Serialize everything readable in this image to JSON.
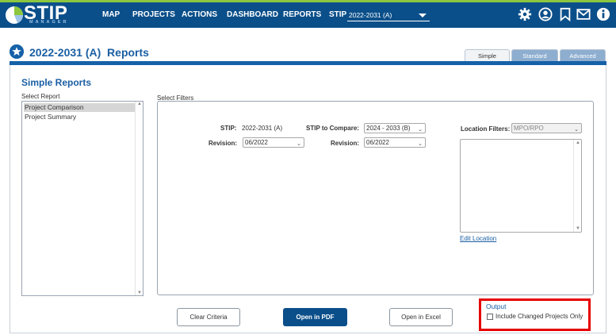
{
  "logo": {
    "text": "STIP",
    "subtext": "MANAGER"
  },
  "nav": {
    "items": [
      "MAP",
      "PROJECTS",
      "ACTIONS",
      "DASHBOARD",
      "REPORTS"
    ],
    "stip_label": "STIP",
    "stip_value": "2022-2031 (A)"
  },
  "toolbar_icons": [
    "gear-icon",
    "user-icon",
    "bookmark-icon",
    "mail-icon",
    "info-icon"
  ],
  "page": {
    "title": "2022-2031 (A)  Reports",
    "tabs": [
      "Simple",
      "Standard",
      "Advanced"
    ],
    "active_tab": "Simple"
  },
  "reports": {
    "section_title": "Simple Reports",
    "select_label": "Select Report",
    "items": [
      "Project Comparison",
      "Project Summary"
    ],
    "selected": "Project Comparison"
  },
  "filters": {
    "label": "Select Filters",
    "stip_label": "STIP:",
    "stip_value": "2022-2031 (A)",
    "compare_label": "STIP to Compare:",
    "compare_value": "2024 - 2033 (B)",
    "revision_label": "Revision:",
    "revision_value": "06/2022",
    "revision2_label": "Revision:",
    "revision2_value": "06/2022",
    "location_label": "Location Filters:",
    "location_value": "MPO/RPO",
    "edit_location": "Edit Location"
  },
  "buttons": {
    "clear": "Clear Criteria",
    "pdf": "Open in PDF",
    "excel": "Open in Excel"
  },
  "output": {
    "title": "Output",
    "checkbox_label": "Include Changed Projects Only",
    "checked": false
  },
  "colors": {
    "nav_bg": "#0b4f8a",
    "accent": "#1561a8",
    "green": "#8cc63f",
    "highlight": "#e60000"
  }
}
